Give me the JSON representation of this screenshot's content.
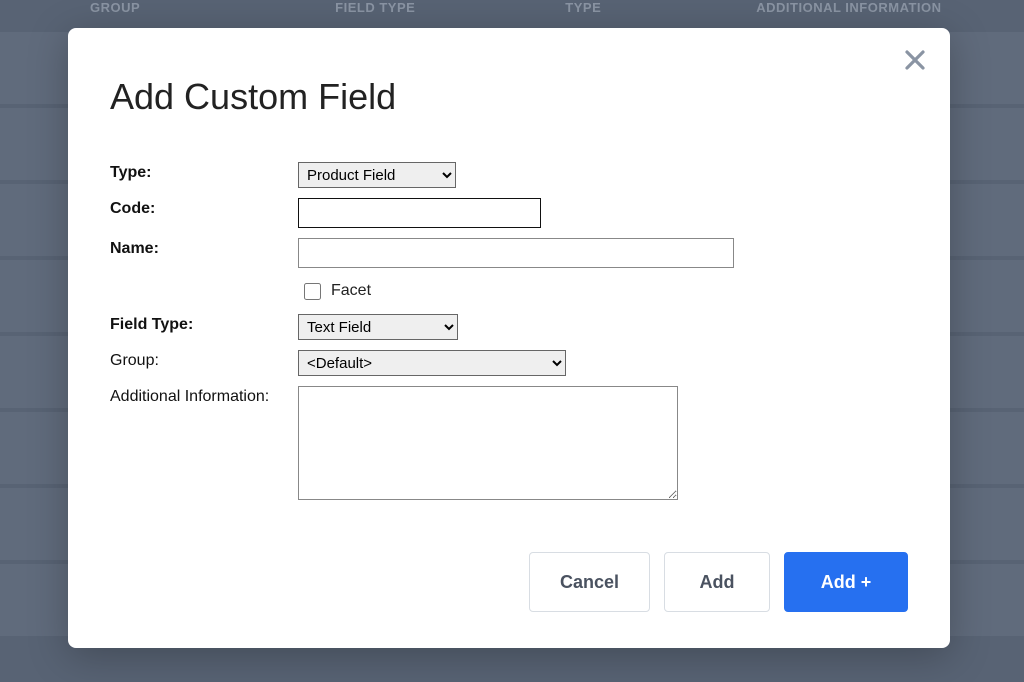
{
  "background": {
    "headers": {
      "group": "GROUP",
      "fieldtype": "FIELD TYPE",
      "type": "TYPE",
      "addinfo": "ADDITIONAL INFORMATION"
    }
  },
  "modal": {
    "title": "Add Custom Field",
    "labels": {
      "type": "Type:",
      "code": "Code:",
      "name": "Name:",
      "facet": "Facet",
      "fieldtype": "Field Type:",
      "group": "Group:",
      "addinfo": "Additional Information:"
    },
    "values": {
      "type": "Product Field",
      "code": "",
      "name": "",
      "facet_checked": false,
      "fieldtype": "Text Field",
      "group": "<Default>",
      "addinfo": ""
    },
    "buttons": {
      "cancel": "Cancel",
      "add": "Add",
      "addplus": "Add +"
    }
  }
}
